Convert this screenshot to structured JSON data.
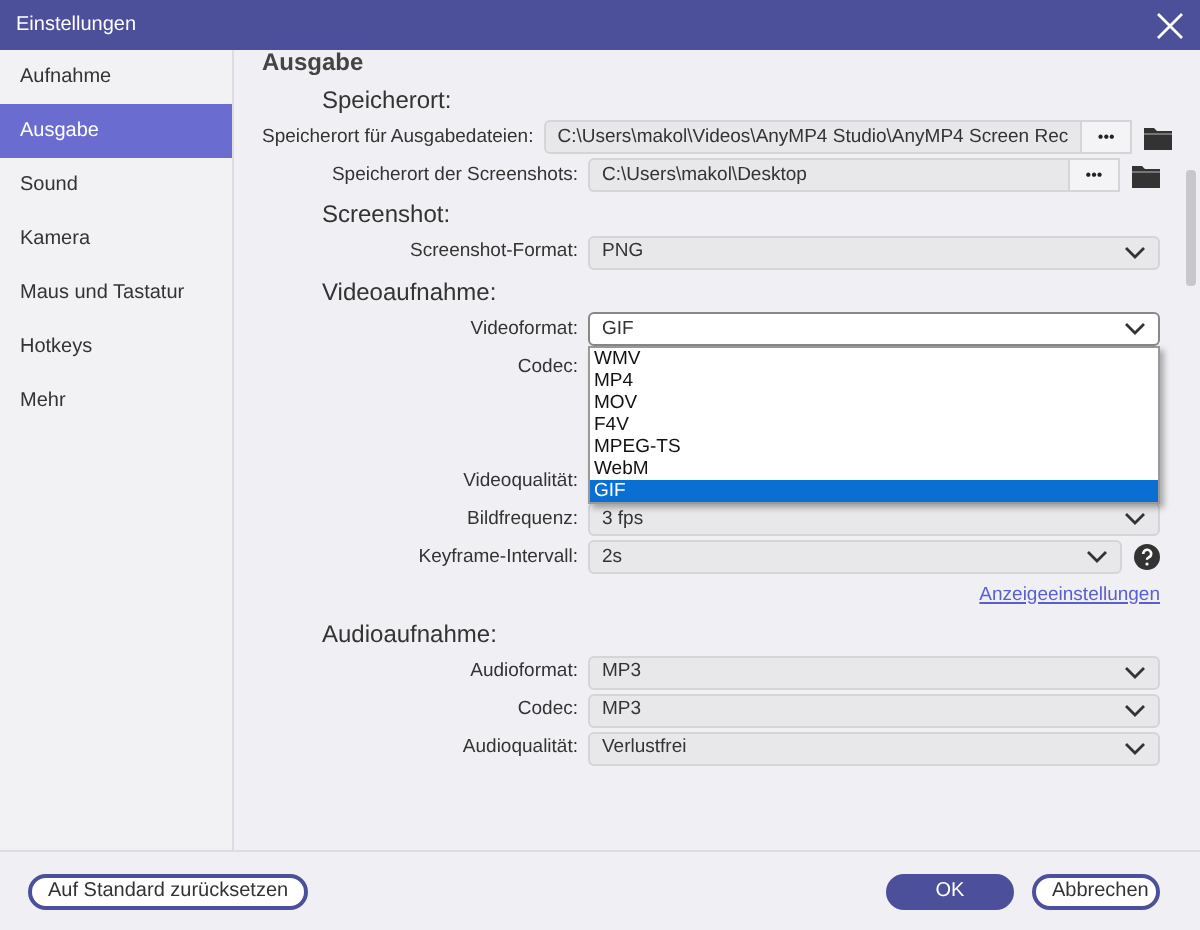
{
  "window": {
    "title": "Einstellungen"
  },
  "sidebar": {
    "items": [
      {
        "label": "Aufnahme",
        "selected": false
      },
      {
        "label": "Ausgabe",
        "selected": true
      },
      {
        "label": "Sound",
        "selected": false
      },
      {
        "label": "Kamera",
        "selected": false
      },
      {
        "label": "Maus und Tastatur",
        "selected": false
      },
      {
        "label": "Hotkeys",
        "selected": false
      },
      {
        "label": "Mehr",
        "selected": false
      }
    ]
  },
  "page_heading": "Ausgabe",
  "groups": [
    {
      "heading": "Speicherort:",
      "rows": [
        {
          "kind": "path",
          "label": "Speicherort für Ausgabedateien:",
          "value": "C:\\Users\\makol\\Videos\\AnyMP4 Studio\\AnyMP4 Screen Rec",
          "button": "•••"
        },
        {
          "kind": "path",
          "label": "Speicherort der Screenshots:",
          "value": "C:\\Users\\makol\\Desktop",
          "button": "•••"
        }
      ]
    },
    {
      "heading": "Screenshot:",
      "rows": [
        {
          "kind": "select",
          "label": "Screenshot-Format:",
          "value": "PNG"
        }
      ]
    },
    {
      "heading": "Videoaufnahme:",
      "rows": [
        {
          "kind": "open_select",
          "label": "Videoformat:",
          "value": "GIF",
          "options": [
            {
              "label": "WMV",
              "selected": false
            },
            {
              "label": "MP4",
              "selected": false
            },
            {
              "label": "MOV",
              "selected": false
            },
            {
              "label": "F4V",
              "selected": false
            },
            {
              "label": "MPEG-TS",
              "selected": false
            },
            {
              "label": "WebM",
              "selected": false
            },
            {
              "label": "GIF",
              "selected": true
            }
          ]
        },
        {
          "kind": "covered",
          "label": "Codec:"
        },
        {
          "kind": "blank"
        },
        {
          "kind": "blank"
        },
        {
          "kind": "covered",
          "label": "Videoqualität:"
        },
        {
          "kind": "select",
          "label": "Bildfrequenz:",
          "value": "3 fps"
        },
        {
          "kind": "help_select",
          "label": "Keyframe-Intervall:",
          "value": "2s"
        }
      ],
      "link": "Anzeigeeinstellungen"
    },
    {
      "heading": "Audioaufnahme:",
      "rows": [
        {
          "kind": "select",
          "label": "Audioformat:",
          "value": "MP3"
        },
        {
          "kind": "select",
          "label": "Codec:",
          "value": "MP3"
        },
        {
          "kind": "select",
          "label": "Audioqualität:",
          "value": "Verlustfrei"
        }
      ]
    }
  ],
  "footer": {
    "reset": "Auf Standard zurücksetzen",
    "ok": "OK",
    "cancel": "Abbrechen"
  }
}
